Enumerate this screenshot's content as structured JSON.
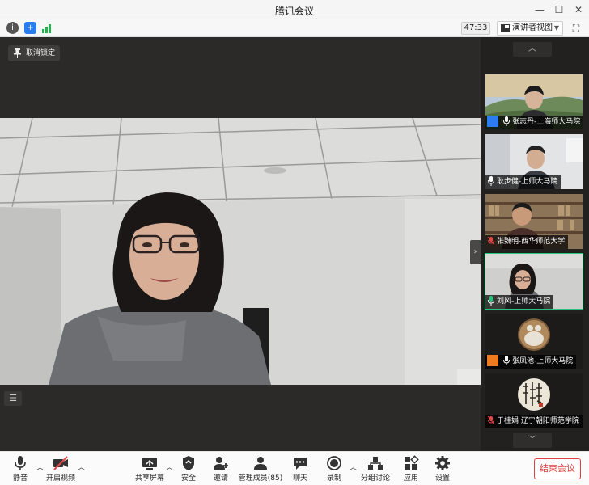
{
  "window": {
    "title": "腾讯会议"
  },
  "infobar": {
    "timer": "47:33",
    "view_label": "演讲者视图"
  },
  "stage": {
    "pin_label": "取消锁定"
  },
  "participants": [
    {
      "name": "张志丹-上海师大马院",
      "host_badge": true,
      "badge_color": "#2b7cf0",
      "mic": "white",
      "bg": "landscape"
    },
    {
      "name": "耿步健-上师大马院",
      "host_badge": false,
      "mic": "white",
      "bg": "office"
    },
    {
      "name": "张魏明-西华师范大学",
      "host_badge": false,
      "mic": "red",
      "bg": "bookshelf"
    },
    {
      "name": "刘风-上师大马院",
      "host_badge": false,
      "mic": "green",
      "active": true,
      "bg": "room"
    },
    {
      "name": "张凤池-上师大马院",
      "host_badge": true,
      "badge_color": "#f07a1e",
      "mic": "white",
      "bg": "avatar-round"
    },
    {
      "name": "于桂娟 辽宁朝阳师范学院",
      "host_badge": false,
      "mic": "red",
      "bg": "calligraphy"
    }
  ],
  "toolbar": {
    "mute": "静音",
    "video": "开启视频",
    "share": "共享屏幕",
    "security": "安全",
    "invite": "邀请",
    "members": "管理成员(85)",
    "chat": "聊天",
    "record": "录制",
    "breakout": "分组讨论",
    "apps": "应用",
    "settings": "设置",
    "end": "结束会议"
  },
  "colors": {
    "end_button": "#e04040",
    "active_speaker": "#1ec97c",
    "host_blue": "#2b7cf0"
  }
}
